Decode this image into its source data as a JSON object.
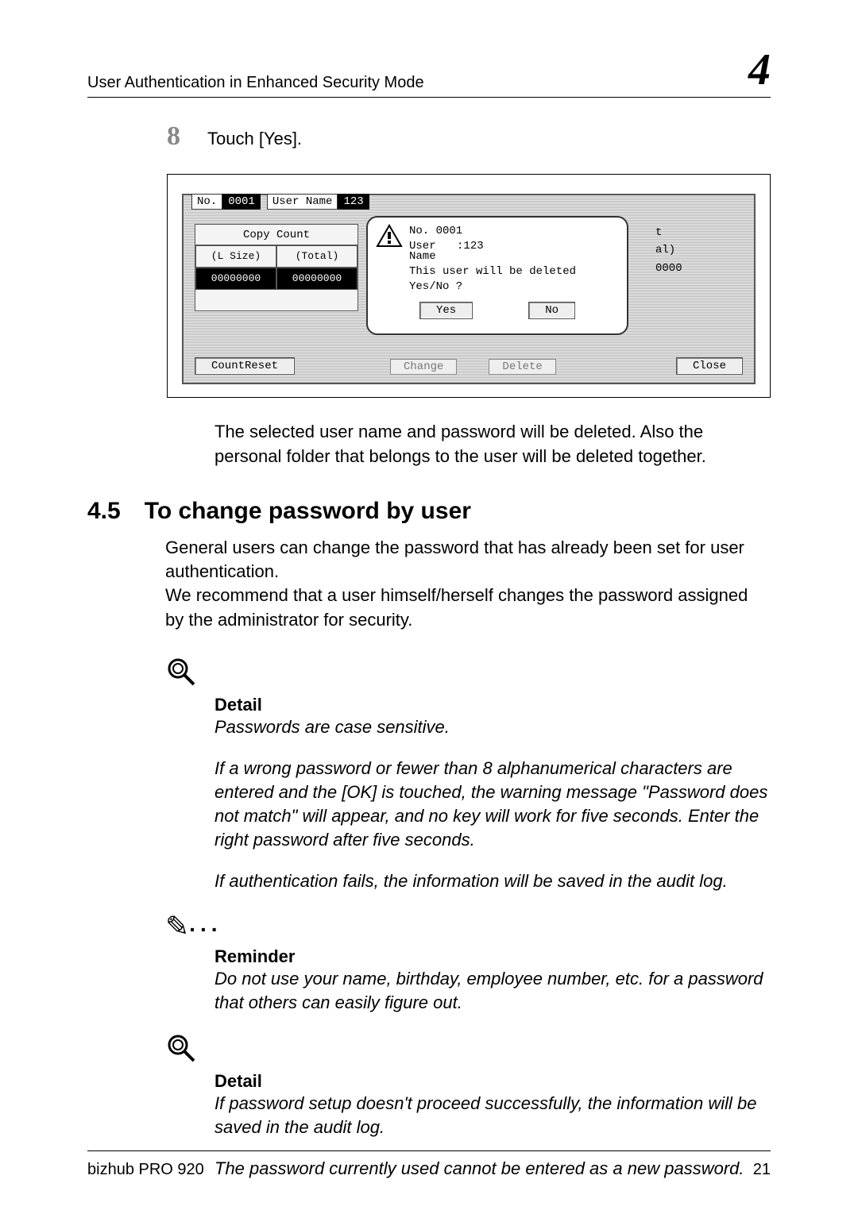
{
  "header": {
    "running_head": "User Authentication in Enhanced Security Mode",
    "chapter_glyph": "4"
  },
  "step": {
    "number": "8",
    "text": "Touch [Yes]."
  },
  "lcd": {
    "no_label": "No.",
    "no_value": "0001",
    "username_label": "User Name",
    "username_value": "123",
    "copycount_header": "Copy Count",
    "lsize_label": "(L Size)",
    "total_label": "(Total)",
    "lsize_value": "00000000",
    "total_value": "00000000",
    "count_reset": "CountReset",
    "modal": {
      "line1": "No. 0001",
      "line2a": "User",
      "line2b": "Name",
      "line2c": ":123",
      "line3": "This user will be deleted",
      "line4": "Yes/No ?",
      "yes": "Yes",
      "no": "No"
    },
    "right": {
      "t": "t",
      "al": "al)",
      "zeros": "0000"
    },
    "bottom_mid": {
      "change": "Change",
      "delete": "Delete"
    },
    "close": "Close"
  },
  "post_sc": "The selected user name and password will be deleted. Also the personal folder that belongs to the user will be deleted together.",
  "section": {
    "number": "4.5",
    "title": "To change password by user",
    "body": "General users can change the password that has already been set for user authentication.\nWe recommend that a user himself/herself changes the password assigned by the administrator for security."
  },
  "detail1": {
    "head": "Detail",
    "p1": "Passwords are case sensitive.",
    "p2": "If a wrong password or fewer than 8 alphanumerical characters are entered and the [OK] is touched, the warning message \"Password does not match\" will appear, and no key will work for five seconds. Enter the right password after five seconds.",
    "p3": "If authentication fails, the information will be saved in the audit log."
  },
  "reminder": {
    "head": "Reminder",
    "p1": "Do not use your name, birthday, employee number, etc. for a password that others can easily figure out."
  },
  "detail2": {
    "head": "Detail",
    "p1": "If password setup doesn't proceed successfully, the information will be saved in the audit log.",
    "p2": "The password currently used cannot be entered as a new password."
  },
  "footer": {
    "left": "bizhub PRO 920",
    "right": "21"
  }
}
